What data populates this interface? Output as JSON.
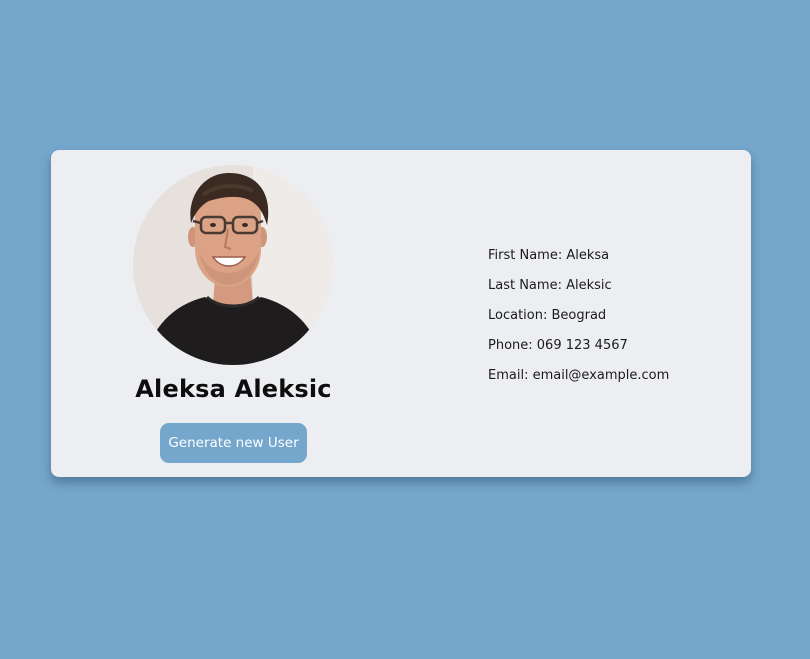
{
  "profile": {
    "full_name": "Aleksa Aleksic",
    "generate_button_label": "Generate new User",
    "photo_icon": "user-photo"
  },
  "details": [
    {
      "label": "First Name",
      "value": "Aleksa",
      "text": "First Name: Aleksa"
    },
    {
      "label": "Last Name",
      "value": "Aleksic",
      "text": "Last Name: Aleksic"
    },
    {
      "label": "Location",
      "value": "Beograd",
      "text": "Location: Beograd"
    },
    {
      "label": "Phone",
      "value": "069 123 4567",
      "text": "Phone: 069 123 4567"
    },
    {
      "label": "Email",
      "value": "email@example.com",
      "text": "Email: email@example.com"
    }
  ],
  "colors": {
    "background": "#75a6cc",
    "card": "#eceef1",
    "button": "#75a6cc",
    "button_text": "#ffffff"
  }
}
